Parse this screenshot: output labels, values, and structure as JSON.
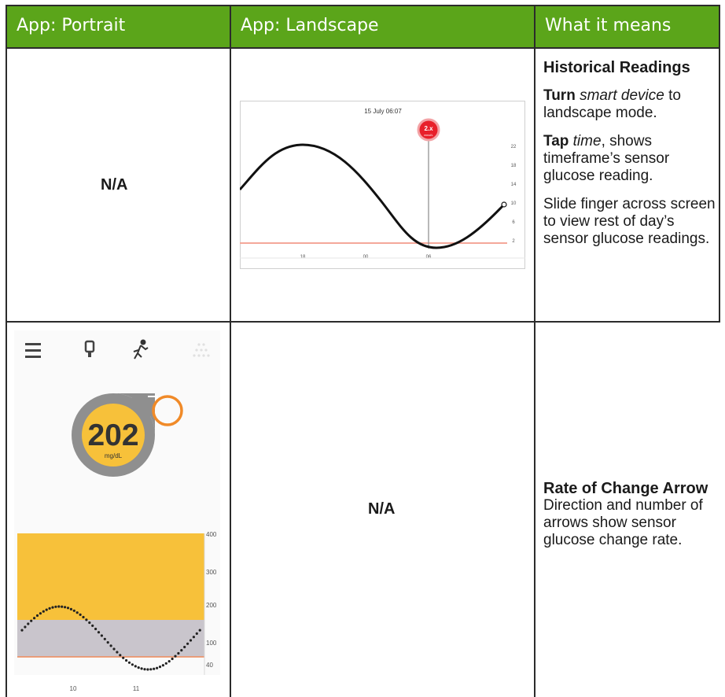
{
  "header": {
    "col1": "App: Portrait",
    "col2": "App: Landscape",
    "col3": "What it means"
  },
  "row1": {
    "portrait": "N/A",
    "landscape_chart": {
      "date_time": "15 July 06:07",
      "marker_value": "2.x",
      "marker_unit": "mmol/L",
      "y_ticks": [
        "22",
        "18",
        "14",
        "10",
        "6",
        "2"
      ],
      "x_ticks": [
        "18",
        "00",
        "06"
      ]
    },
    "desc_title": "Historical Readings",
    "p1_bold": "Turn",
    "p1_italic": "smart device",
    "p1_rest": "to landscape mode.",
    "p2_bold": "Tap",
    "p2_italic": "time",
    "p2_rest": ", shows timeframe’s sensor glucose reading.",
    "p3": "Slide finger across screen to view rest of day’s sensor glucose readings."
  },
  "row2": {
    "portrait_app": {
      "reading_value": "202",
      "reading_unit": "mg/dL",
      "y_ticks": [
        "400",
        "300",
        "200",
        "100",
        "40"
      ],
      "x_ticks": [
        "10",
        "11"
      ],
      "icons": [
        "menu-icon",
        "sensor-icon",
        "exercise-icon",
        "dots-icon"
      ],
      "colors": {
        "high": "#f7c13a",
        "target": "#c9c5cc",
        "low_line": "#f08a5a",
        "highlight": "#f08a28"
      }
    },
    "landscape": "N/A",
    "desc_title": "Rate of Change Arrow",
    "desc_text": "Direction and number of arrows show sensor glucose change rate."
  }
}
